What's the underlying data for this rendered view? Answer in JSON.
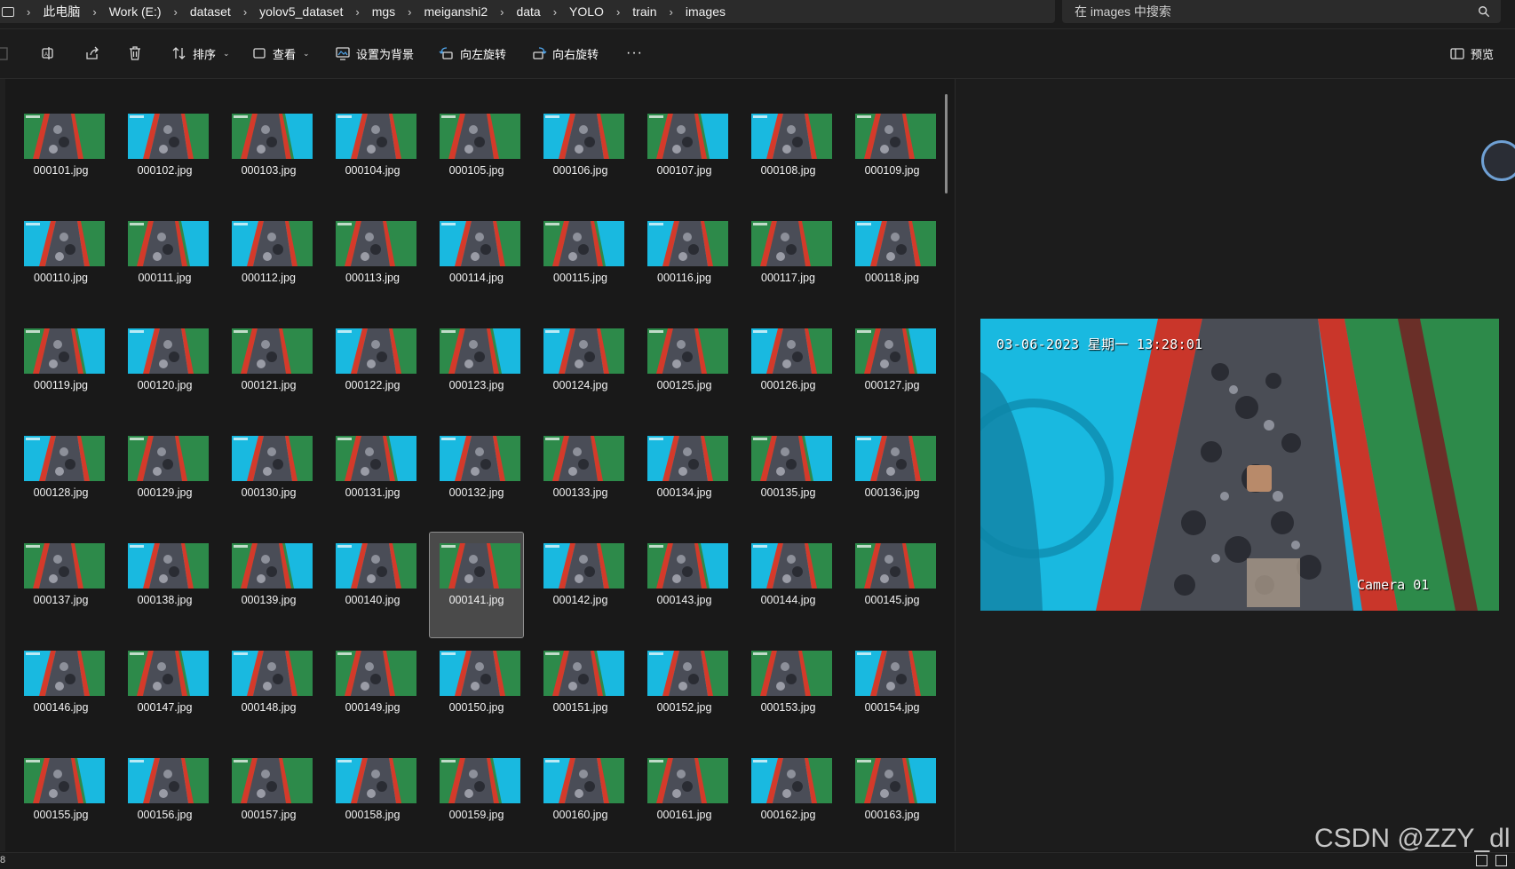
{
  "breadcrumb": [
    "此电脑",
    "Work (E:)",
    "dataset",
    "yolov5_dataset",
    "mgs",
    "meiganshi2",
    "data",
    "YOLO",
    "train",
    "images"
  ],
  "search": {
    "placeholder": "在 images 中搜索"
  },
  "toolbar": {
    "sort_label": "排序",
    "view_label": "查看",
    "set_background_label": "设置为背景",
    "rotate_left_label": "向左旋转",
    "rotate_right_label": "向右旋转",
    "more_label": "···",
    "preview_label": "预览"
  },
  "files": [
    "000101.jpg",
    "000102.jpg",
    "000103.jpg",
    "000104.jpg",
    "000105.jpg",
    "000106.jpg",
    "000107.jpg",
    "000108.jpg",
    "000109.jpg",
    "000110.jpg",
    "000111.jpg",
    "000112.jpg",
    "000113.jpg",
    "000114.jpg",
    "000115.jpg",
    "000116.jpg",
    "000117.jpg",
    "000118.jpg",
    "000119.jpg",
    "000120.jpg",
    "000121.jpg",
    "000122.jpg",
    "000123.jpg",
    "000124.jpg",
    "000125.jpg",
    "000126.jpg",
    "000127.jpg",
    "000128.jpg",
    "000129.jpg",
    "000130.jpg",
    "000131.jpg",
    "000132.jpg",
    "000133.jpg",
    "000134.jpg",
    "000135.jpg",
    "000136.jpg",
    "000137.jpg",
    "000138.jpg",
    "000139.jpg",
    "000140.jpg",
    "000141.jpg",
    "000142.jpg",
    "000143.jpg",
    "000144.jpg",
    "000145.jpg",
    "000146.jpg",
    "000147.jpg",
    "000148.jpg",
    "000149.jpg",
    "000150.jpg",
    "000151.jpg",
    "000152.jpg",
    "000153.jpg",
    "000154.jpg",
    "000155.jpg",
    "000156.jpg",
    "000157.jpg",
    "000158.jpg",
    "000159.jpg",
    "000160.jpg",
    "000161.jpg",
    "000162.jpg",
    "000163.jpg"
  ],
  "selected_file": "000141.jpg",
  "preview": {
    "timestamp": "03-06-2023 星期一 13:28:01",
    "camera_label": "Camera 01"
  },
  "statusbar": {
    "count_text": "8"
  },
  "watermark": "CSDN @ZZY_dl",
  "colors": {
    "background": "#191919",
    "bar": "#1c1c1c",
    "field": "#2b2b2b",
    "selected_tile": "#4a4a4a",
    "conveyor_blue": "#19b9e0",
    "conveyor_green": "#2d8a4a",
    "conveyor_red": "#d43a2a",
    "coal": "#3a3d45"
  }
}
